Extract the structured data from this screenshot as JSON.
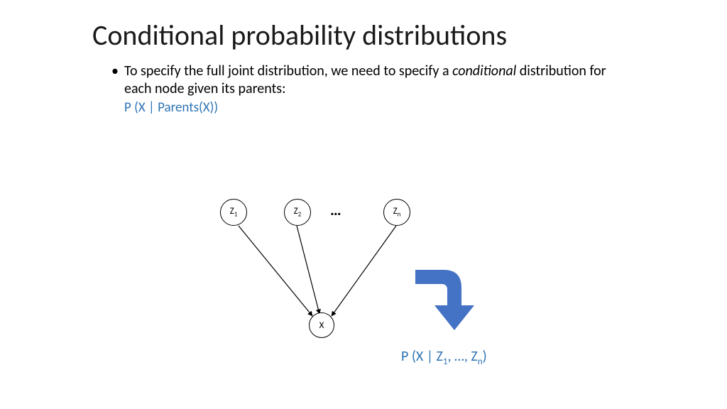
{
  "title": "Conditional probability distributions",
  "bullet": {
    "pre": "To specify the full joint distribution, we need to specify a ",
    "italic": "conditional",
    "post": " distribution for each node given its parents:",
    "formula": "P (X | Parents(X))"
  },
  "nodes": {
    "z1": "Z",
    "z1_sub": "1",
    "z2": "Z",
    "z2_sub": "2",
    "zn": "Z",
    "zn_sub": "n",
    "x": "X",
    "dots": "…"
  },
  "result": {
    "pre": "P (X | Z",
    "sub1": "1",
    "mid": ", …, Z",
    "sub2": "n",
    "post": ")"
  },
  "colors": {
    "accent_blue": "#2e74b5",
    "arrow_blue": "#4472C4"
  }
}
